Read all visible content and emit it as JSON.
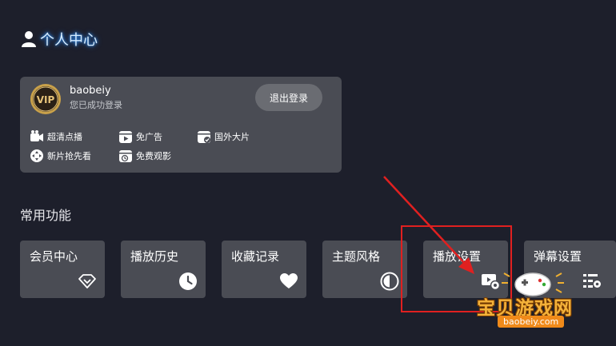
{
  "page": {
    "title": "个人中心"
  },
  "account": {
    "username": "baobeiy",
    "status": "您已成功登录",
    "vip_label": "VIP",
    "logout_label": "退出登录"
  },
  "perks": [
    {
      "label": "超清点播",
      "icon": "video-camera-icon"
    },
    {
      "label": "免广告",
      "icon": "no-ads-play-icon"
    },
    {
      "label": "国外大片",
      "icon": "foreign-movie-icon"
    },
    {
      "label": "新片抢先看",
      "icon": "gamepad-icon"
    },
    {
      "label": "免费观影",
      "icon": "free-watch-clock-icon"
    }
  ],
  "common": {
    "title": "常用功能",
    "tiles": [
      {
        "label": "会员中心",
        "icon": "diamond-icon"
      },
      {
        "label": "播放历史",
        "icon": "clock-icon"
      },
      {
        "label": "收藏记录",
        "icon": "heart-icon"
      },
      {
        "label": "主题风格",
        "icon": "contrast-icon"
      },
      {
        "label": "播放设置",
        "icon": "play-settings-icon"
      },
      {
        "label": "弹幕设置",
        "icon": "danmaku-settings-icon"
      }
    ]
  },
  "watermark": {
    "brand": "宝贝游戏网",
    "url": "baobeiy.com"
  },
  "colors": {
    "background": "#1d1f2b",
    "card": "#4a4c54",
    "highlight": "#e02020",
    "title_glow": "#3aa0ff"
  }
}
